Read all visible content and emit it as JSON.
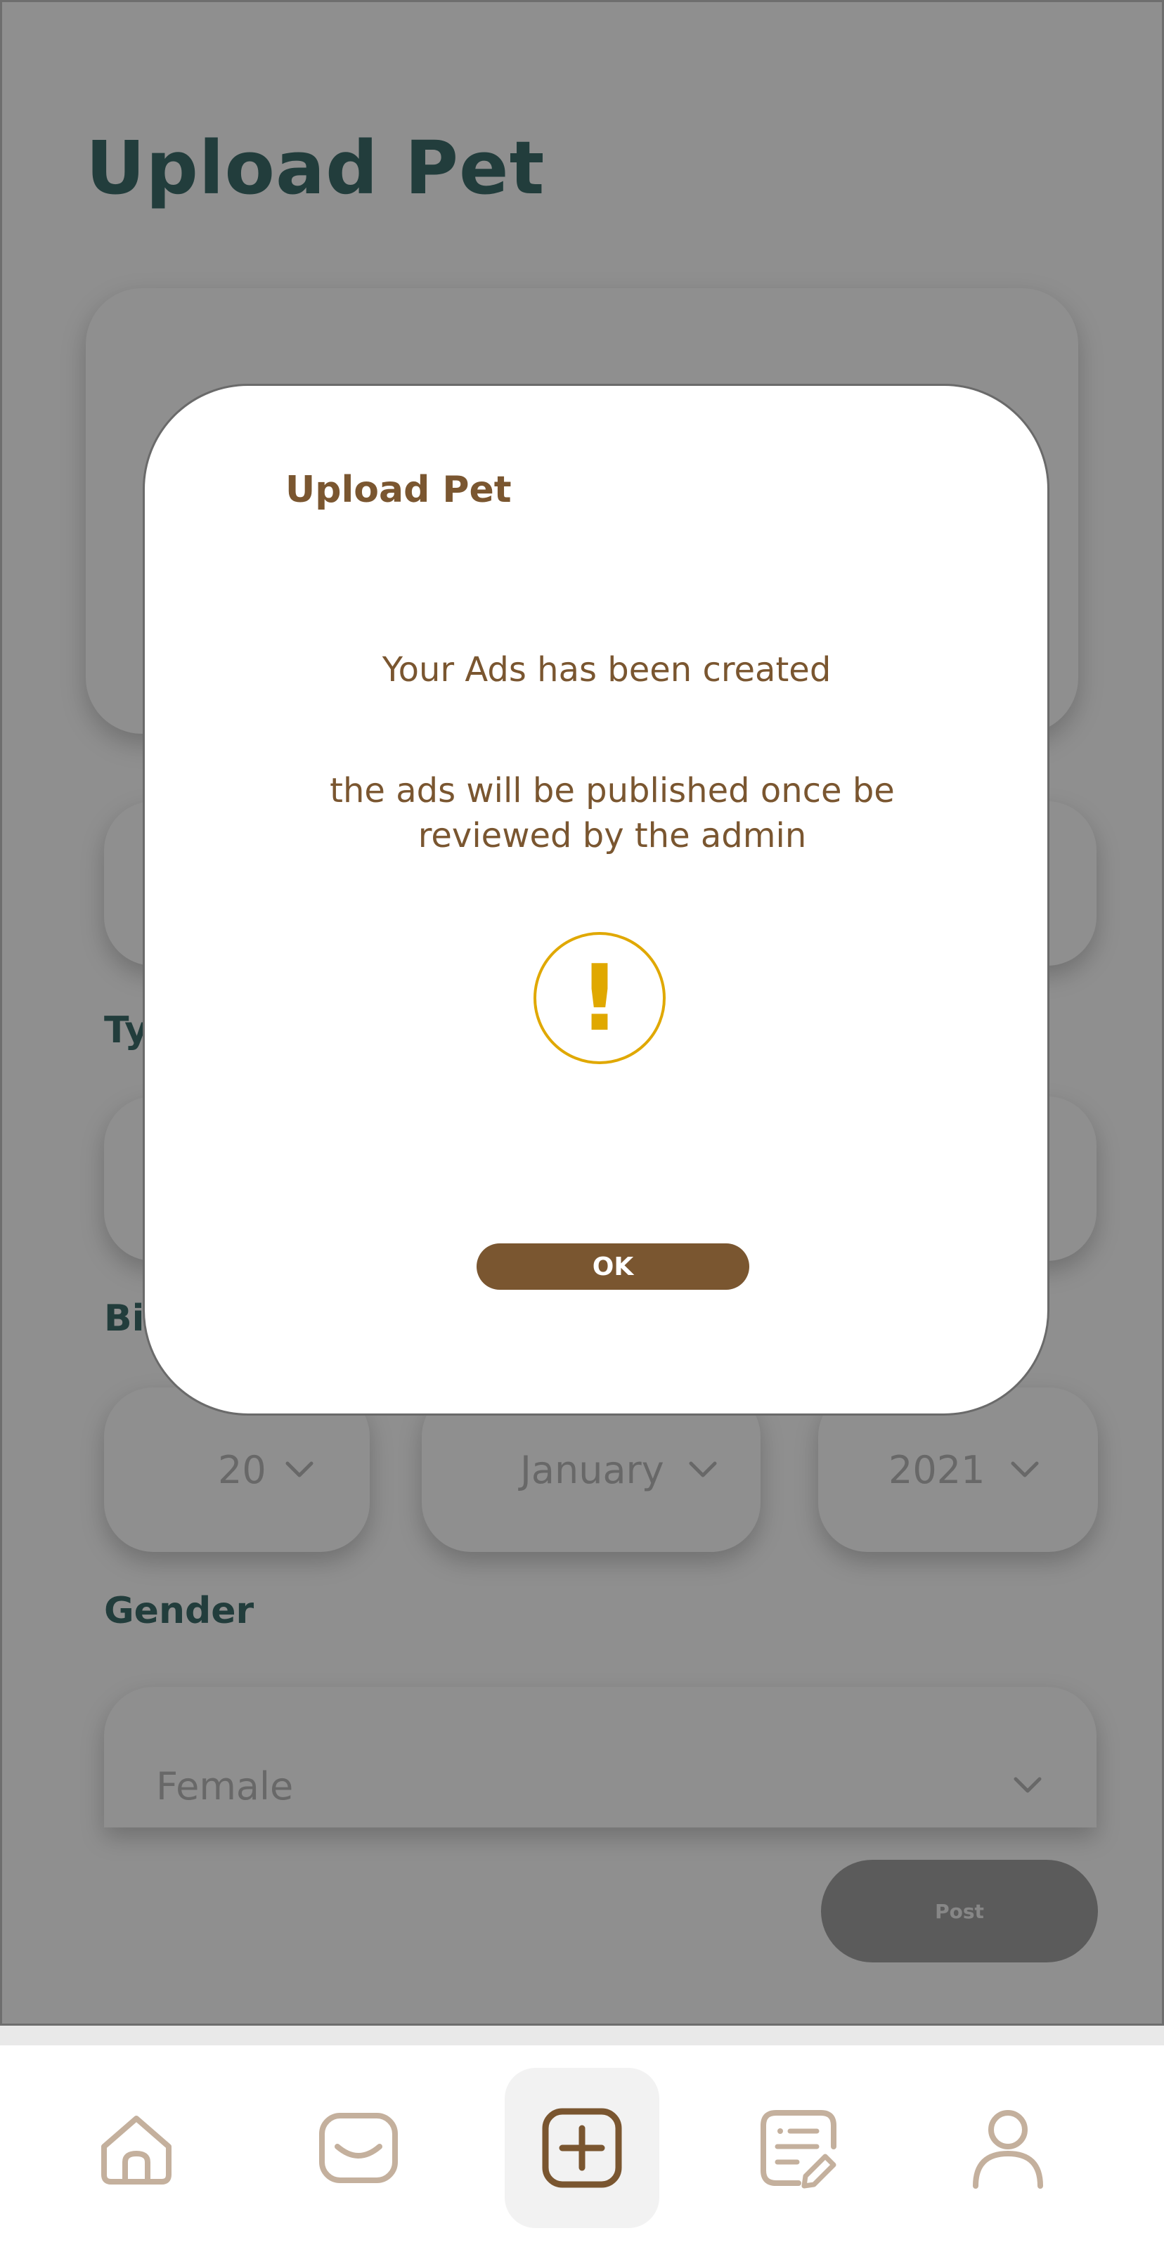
{
  "page": {
    "title": "Upload Pet",
    "labels": {
      "type_partial": "Ty",
      "birthdate_partial": "Bi",
      "gender": "Gender"
    },
    "birth": {
      "day": "20",
      "month": "January",
      "year": "2021"
    },
    "gender_value": "Female",
    "post_label": "Post"
  },
  "modal": {
    "title": "Upload Pet",
    "message_primary": "Your Ads has been created",
    "message_secondary": "the ads will be published once be reviewed by the admin",
    "alert_glyph": "!",
    "ok_label": "OK"
  },
  "nav": {
    "items": [
      {
        "icon": "home-icon",
        "active": false
      },
      {
        "icon": "inbox-icon",
        "active": false
      },
      {
        "icon": "add-square-icon",
        "active": true
      },
      {
        "icon": "listing-edit-icon",
        "active": false
      },
      {
        "icon": "profile-icon",
        "active": false
      }
    ]
  },
  "colors": {
    "title_teal": "#3d6e6c",
    "brown": "#7a5630",
    "alert_yellow": "#e0a800",
    "icon_tan": "#c4b09d"
  }
}
